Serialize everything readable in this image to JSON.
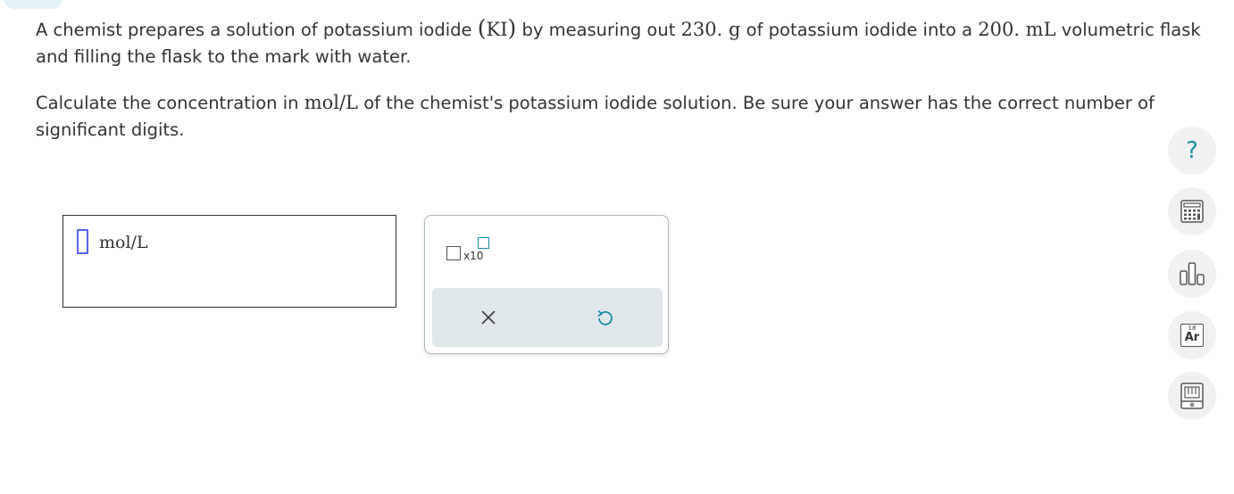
{
  "question": {
    "p1": {
      "t1": "A chemist prepares a solution of potassium iodide ",
      "open_paren": "(",
      "formula": "KI",
      "close_paren": ")",
      "t2": " by measuring out ",
      "mass": "230. g",
      "t3": " of potassium iodide into a ",
      "volume": "200. mL",
      "t4": " volumetric flask and filling the flask to the mark with water."
    },
    "p2": {
      "t1": "Calculate the concentration in ",
      "unit": "mol/L",
      "t2": " of the chemist's potassium iodide solution. Be sure your answer has the correct number of significant digits."
    }
  },
  "answer": {
    "value": "",
    "unit": "mol/L"
  },
  "tools": {
    "sci_notation_label": "x10"
  },
  "sidebar": {
    "help_symbol": "?",
    "periodic_table": {
      "number": "18",
      "symbol": "Ar"
    }
  },
  "colors": {
    "accent": "#1a8fa6",
    "cursor": "#5a61f0",
    "action_bar": "#e0e7ea",
    "side_button": "#f1f1f1"
  },
  "icons": [
    "help-icon",
    "calculator-icon",
    "bar-chart-icon",
    "periodic-table-icon",
    "reference-book-icon",
    "clear-x-icon",
    "undo-icon"
  ]
}
